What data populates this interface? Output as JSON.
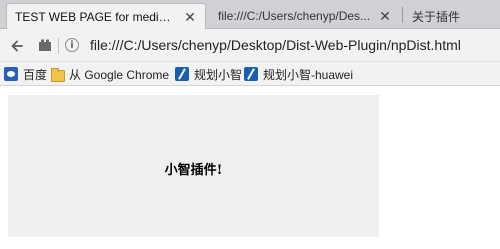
{
  "tabs": [
    {
      "title": "TEST WEB PAGE for media ...",
      "active": true,
      "close": "✕"
    },
    {
      "title": "file:///C:/Users/chenyp/Des...",
      "active": false,
      "close": "✕"
    },
    {
      "title": "关于插件",
      "active": false
    }
  ],
  "toolbar": {
    "back_icon": "back-arrow-icon",
    "info_symbol": "i",
    "url": "file:///C:/Users/chenyp/Desktop/Dist-Web-Plugin/npDist.html"
  },
  "bookmarks": [
    {
      "label": "百度",
      "icon": "baidu-paw-icon"
    },
    {
      "label": "从 Google Chrome",
      "icon": "folder-icon"
    },
    {
      "label": "规划小智",
      "icon": "bookmark-pen-icon"
    },
    {
      "label": "规划小智-huawei",
      "icon": "bookmark-pen-icon"
    }
  ],
  "content": {
    "plugin_text": "小智插件!"
  },
  "colors": {
    "tabstrip": "#cfd1d5",
    "toolbar": "#f2f2f2",
    "plugin_bg": "#efefef"
  }
}
